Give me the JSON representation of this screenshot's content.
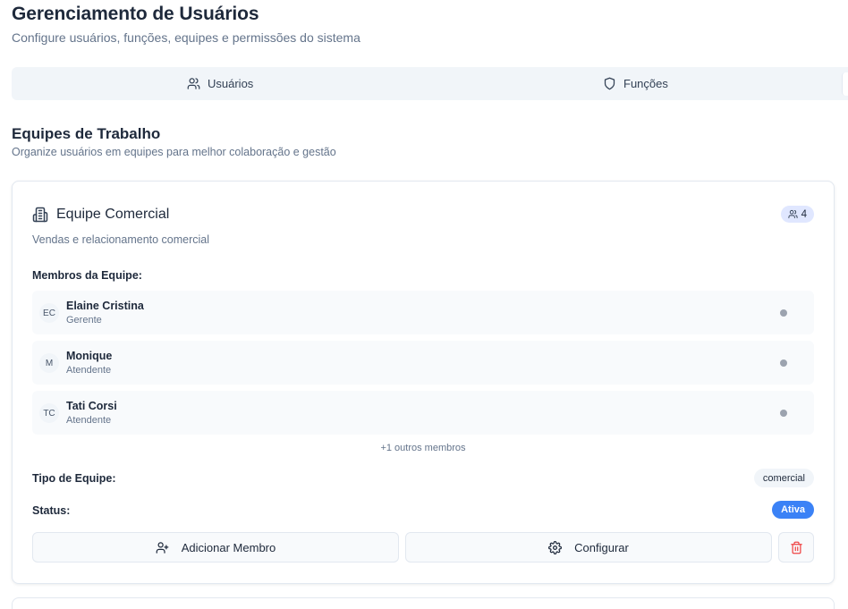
{
  "header": {
    "title": "Gerenciamento de Usuários",
    "subtitle": "Configure usuários, funções, equipes e permissões do sistema"
  },
  "tabs": [
    {
      "label": "Usuários",
      "icon": "users-icon"
    },
    {
      "label": "Funções",
      "icon": "shield-icon"
    }
  ],
  "section": {
    "title": "Equipes de Trabalho",
    "subtitle": "Organize usuários em equipes para melhor colaboração e gestão"
  },
  "team": {
    "icon": "building-icon",
    "name": "Equipe Comercial",
    "member_count": "4",
    "description": "Vendas e relacionamento comercial",
    "members_label": "Membros da Equipe:",
    "members": [
      {
        "initials": "EC",
        "name": "Elaine Cristina",
        "role": "Gerente"
      },
      {
        "initials": "M",
        "name": "Monique",
        "role": "Atendente"
      },
      {
        "initials": "TC",
        "name": "Tati Corsi",
        "role": "Atendente"
      }
    ],
    "more_members": "+1 outros membros",
    "type_label": "Tipo de Equipe:",
    "type_value": "comercial",
    "status_label": "Status:",
    "status_value": "Ativa",
    "add_member_label": "Adicionar Membro",
    "configure_label": "Configurar"
  },
  "colors": {
    "accent": "#3b82f6",
    "danger": "#ef4444",
    "count_badge_bg": "#e0e7ff",
    "muted_text": "#64748b"
  }
}
